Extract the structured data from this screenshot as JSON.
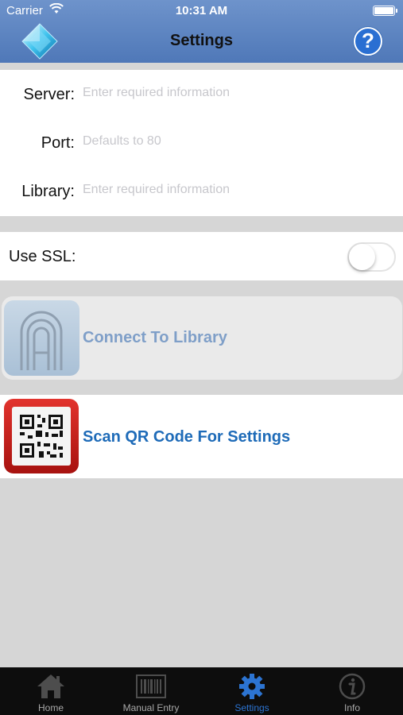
{
  "status_bar": {
    "carrier": "Carrier",
    "time": "10:31 AM"
  },
  "nav": {
    "title": "Settings",
    "help_symbol": "?"
  },
  "form": {
    "server": {
      "label": "Server:",
      "placeholder": "Enter required information"
    },
    "port": {
      "label": "Port:",
      "placeholder": "Defaults to 80"
    },
    "library": {
      "label": "Library:",
      "placeholder": "Enter required information"
    }
  },
  "ssl": {
    "label": "Use SSL:",
    "enabled": false
  },
  "actions": {
    "connect": {
      "label": "Connect To Library",
      "icon": "library-arch-icon"
    },
    "scan": {
      "label": "Scan QR Code For Settings",
      "icon": "qr-code-icon"
    }
  },
  "tabbar": {
    "tabs": [
      {
        "label": "Home",
        "icon": "home-icon",
        "active": false
      },
      {
        "label": "Manual Entry",
        "icon": "barcode-icon",
        "active": false
      },
      {
        "label": "Settings",
        "icon": "gear-icon",
        "active": true
      },
      {
        "label": "Info",
        "icon": "info-icon",
        "active": false
      }
    ]
  },
  "colors": {
    "header": "#5a82c0",
    "accent": "#2c74d2",
    "connect_text": "#7f9fc8",
    "scan_text": "#1e6bb8",
    "background": "#d6d6d6"
  }
}
